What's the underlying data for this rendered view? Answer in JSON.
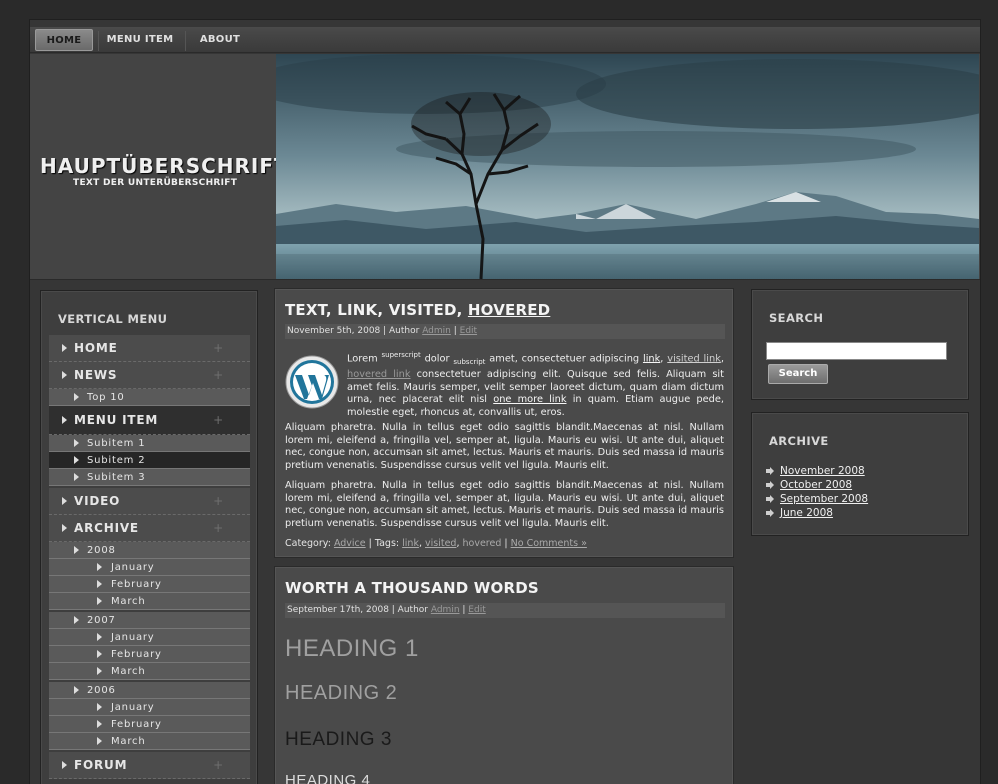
{
  "topnav": {
    "items": [
      "HOME",
      "MENU ITEM",
      "ABOUT"
    ]
  },
  "header": {
    "title": "HAUPTÜBERSCHRIFT",
    "subtitle": "TEXT DER UNTERÜBERSCHRIFT"
  },
  "leftbar": {
    "title": "VERTICAL MENU",
    "items": [
      "HOME",
      "NEWS",
      "Top 10",
      "MENU ITEM",
      "Subitem 1",
      "Subitem 2",
      "Subitem 3",
      "VIDEO",
      "ARCHIVE",
      "2008",
      "January",
      "February",
      "March",
      "2007",
      "January",
      "February",
      "March",
      "2006",
      "January",
      "February",
      "March",
      "FORUM"
    ],
    "plus": "+"
  },
  "post1": {
    "title_pre": "TEXT, LINK, VISITED, ",
    "title_hover": "HOVERED",
    "meta_date": "November 5th, 2008",
    "meta_sep1": " | Author ",
    "meta_author": "Admin",
    "meta_sep2": " | ",
    "meta_edit": "Edit",
    "p1": {
      "t1": "Lorem ",
      "sup": "superscript",
      "t2": " dolor ",
      "sub": "subscript",
      "t3": " amet, consectetuer adipiscing ",
      "link": "link",
      "t4": ", ",
      "visited": "visited link",
      "t5": ", ",
      "hovered": "hovered link",
      "t6": " consectetuer adipiscing elit. Quisque sed felis. Aliquam sit amet felis. Mauris semper, velit semper laoreet dictum, quam diam dictum urna, nec placerat elit nisl ",
      "more": "one more link",
      "t7": " in quam. Etiam augue pede, molestie eget, rhoncus at, convallis ut, eros."
    },
    "p2": "Aliquam pharetra. Nulla in tellus eget odio sagittis blandit.Maecenas at nisl. Nullam lorem mi, eleifend a, fringilla vel, semper at, ligula. Mauris eu wisi. Ut ante dui, aliquet nec, congue non, accumsan sit amet, lectus. Mauris et mauris. Duis sed massa id mauris pretium venenatis. Suspendisse cursus velit vel ligula. Mauris elit.",
    "p3": "Aliquam pharetra. Nulla in tellus eget odio sagittis blandit.Maecenas at nisl. Nullam lorem mi, eleifend a, fringilla vel, semper at, ligula. Mauris eu wisi. Ut ante dui, aliquet nec, congue non, accumsan sit amet, lectus. Mauris et mauris. Duis sed massa id mauris pretium venenatis. Suspendisse cursus velit vel ligula. Mauris elit.",
    "footer": {
      "cat_label": "Category: ",
      "cat": "Advice",
      "tags_label": " | Tags: ",
      "tag1": "link",
      "comma1": ", ",
      "tag2": "visited",
      "comma2": ", ",
      "tag3": "hovered",
      "sep": " | ",
      "comments": "No Comments »"
    }
  },
  "post2": {
    "title": "WORTH A THOUSAND WORDS",
    "meta_date": "September 17th, 2008",
    "meta_sep1": " | Author ",
    "meta_author": "Admin",
    "meta_sep2": " | ",
    "meta_edit": "Edit",
    "h1": "HEADING 1",
    "h2": "HEADING 2",
    "h3": "HEADING 3",
    "h4": "HEADING 4"
  },
  "search": {
    "title": "SEARCH",
    "value": "",
    "button": "Search"
  },
  "archive": {
    "title": "ARCHIVE",
    "items": [
      "November 2008",
      "October 2008",
      "September 2008",
      "June 2008"
    ]
  },
  "colors": {
    "page_bg": "#2a2a2a",
    "panel": "#3e3e3e",
    "post_bg": "#4a4a4a",
    "text": "#e6e6e6"
  }
}
